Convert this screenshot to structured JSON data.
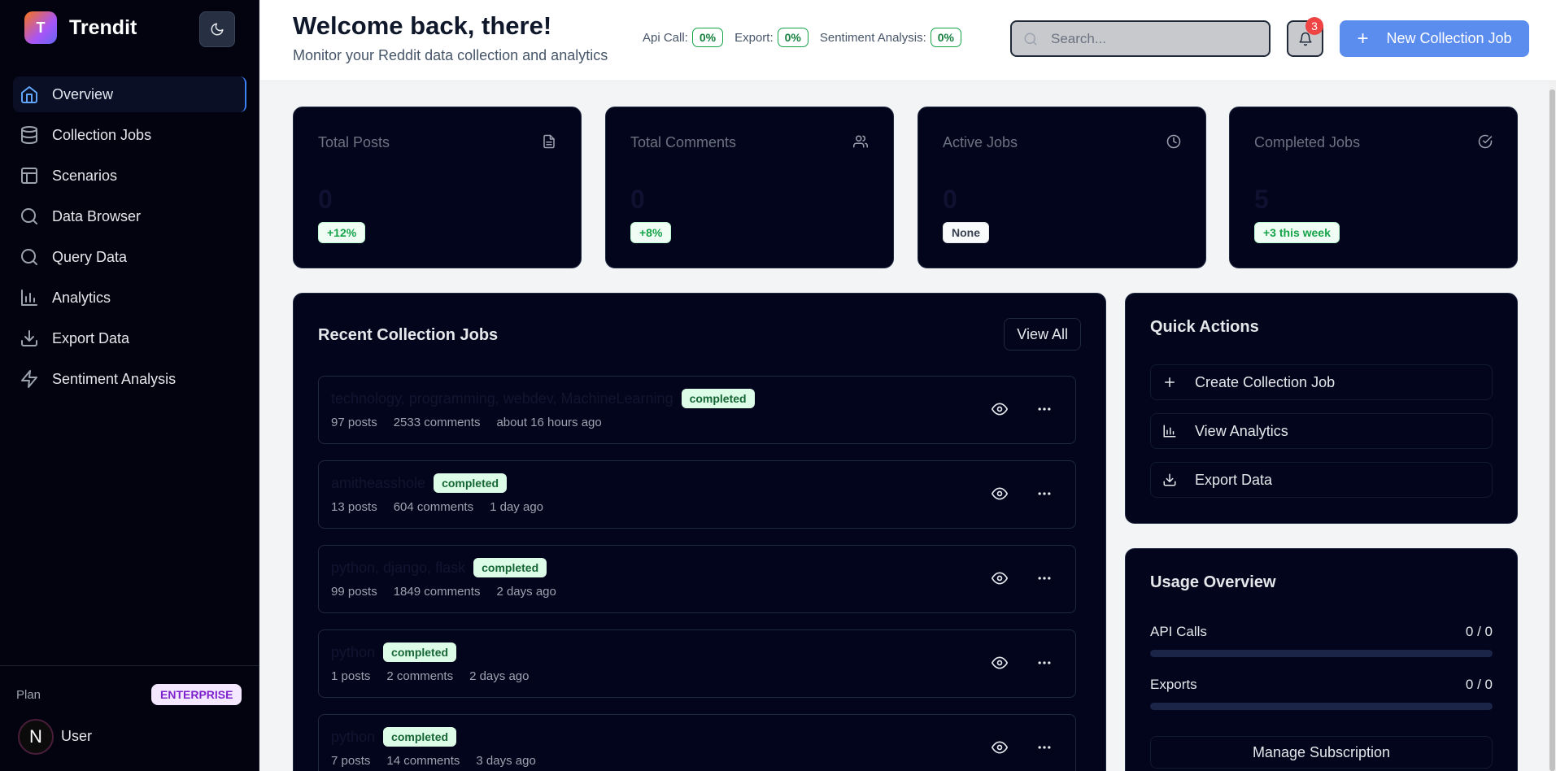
{
  "app": {
    "name": "Trendit",
    "logo_letter": "T"
  },
  "sidebar": {
    "items": [
      {
        "label": "Overview",
        "icon": "home-icon"
      },
      {
        "label": "Collection Jobs",
        "icon": "database-icon"
      },
      {
        "label": "Scenarios",
        "icon": "layout-icon"
      },
      {
        "label": "Data Browser",
        "icon": "search-icon"
      },
      {
        "label": "Query Data",
        "icon": "search-icon"
      },
      {
        "label": "Analytics",
        "icon": "bar-chart-icon"
      },
      {
        "label": "Export Data",
        "icon": "download-icon"
      },
      {
        "label": "Sentiment Analysis",
        "icon": "zap-icon"
      }
    ],
    "plan_label": "Plan",
    "plan_badge": "ENTERPRISE",
    "user_initial": "N",
    "user_name": "User"
  },
  "header": {
    "title": "Welcome back, there!",
    "subtitle": "Monitor your Reddit data collection and analytics",
    "stats": [
      {
        "label": "Api Call:",
        "value": "0%"
      },
      {
        "label": "Export:",
        "value": "0%"
      },
      {
        "label": "Sentiment Analysis:",
        "value": "0%"
      }
    ],
    "search_placeholder": "Search...",
    "notification_count": "3",
    "new_job_label": "New Collection Job"
  },
  "stat_cards": [
    {
      "title": "Total Posts",
      "value": "0",
      "badge": "+12%",
      "icon": "file-icon"
    },
    {
      "title": "Total Comments",
      "value": "0",
      "badge": "+8%",
      "icon": "users-icon"
    },
    {
      "title": "Active Jobs",
      "value": "0",
      "badge": "None",
      "icon": "clock-icon"
    },
    {
      "title": "Completed Jobs",
      "value": "5",
      "badge": "+3 this week",
      "icon": "check-circle-icon"
    }
  ],
  "recent_jobs": {
    "title": "Recent Collection Jobs",
    "view_all": "View All",
    "rows": [
      {
        "name": "technology, programming, webdev, MachineLearning",
        "status": "completed",
        "posts": "97 posts",
        "comments": "2533 comments",
        "time": "about 16 hours ago"
      },
      {
        "name": "amitheasshole",
        "status": "completed",
        "posts": "13 posts",
        "comments": "604 comments",
        "time": "1 day ago"
      },
      {
        "name": "python, django, flask",
        "status": "completed",
        "posts": "99 posts",
        "comments": "1849 comments",
        "time": "2 days ago"
      },
      {
        "name": "python",
        "status": "completed",
        "posts": "1 posts",
        "comments": "2 comments",
        "time": "2 days ago"
      },
      {
        "name": "python",
        "status": "completed",
        "posts": "7 posts",
        "comments": "14 comments",
        "time": "3 days ago"
      }
    ]
  },
  "quick_actions": {
    "title": "Quick Actions",
    "items": [
      {
        "label": "Create Collection Job",
        "icon": "plus-icon"
      },
      {
        "label": "View Analytics",
        "icon": "bar-chart-icon"
      },
      {
        "label": "Export Data",
        "icon": "download-icon"
      }
    ]
  },
  "usage": {
    "title": "Usage Overview",
    "rows": [
      {
        "label": "API Calls",
        "value": "0 / 0",
        "fraction": 0
      },
      {
        "label": "Exports",
        "value": "0 / 0",
        "fraction": 0
      }
    ],
    "manage_label": "Manage Subscription"
  }
}
